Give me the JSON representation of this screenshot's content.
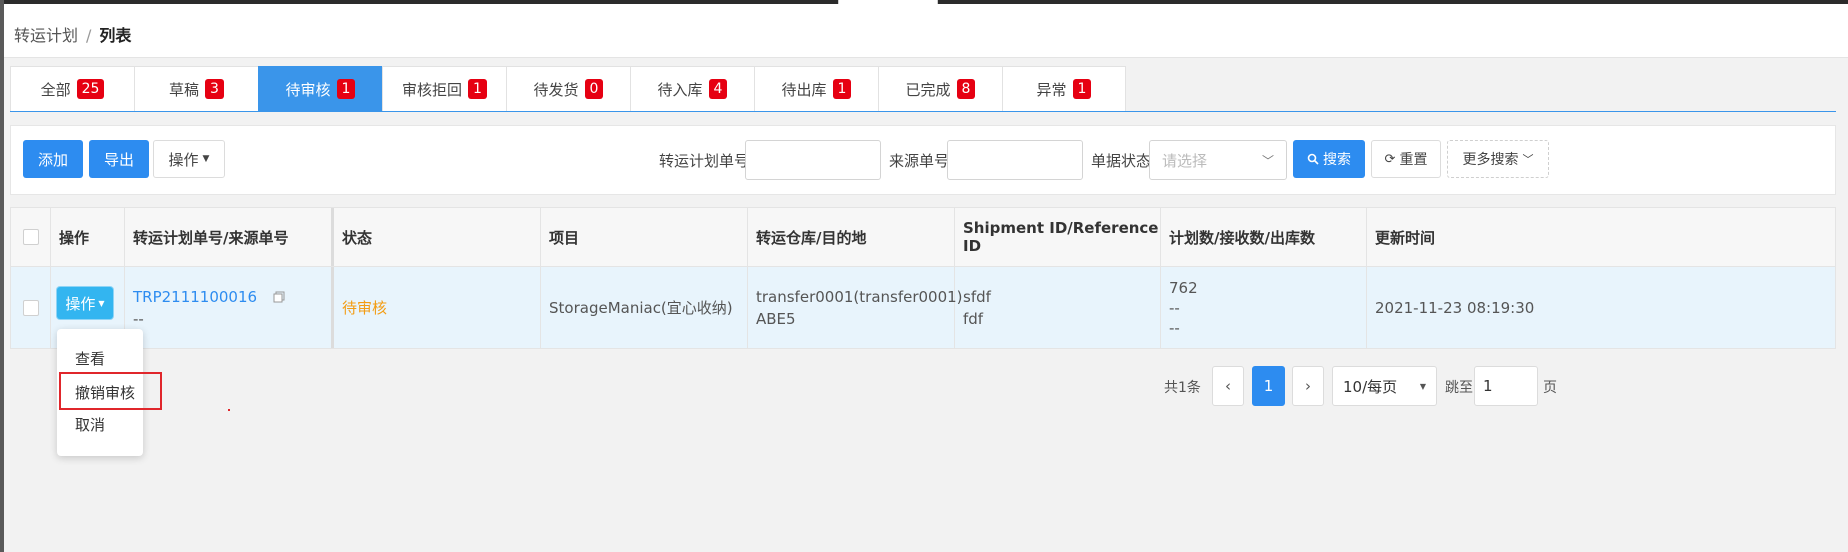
{
  "breadcrumb": {
    "parent": "转运计划",
    "separator": "/",
    "current": "列表"
  },
  "tabs": [
    {
      "label": "全部",
      "count": "25"
    },
    {
      "label": "草稿",
      "count": "3"
    },
    {
      "label": "待审核",
      "count": "1"
    },
    {
      "label": "审核拒回",
      "count": "1"
    },
    {
      "label": "待发货",
      "count": "0"
    },
    {
      "label": "待入库",
      "count": "4"
    },
    {
      "label": "待出库",
      "count": "1"
    },
    {
      "label": "已完成",
      "count": "8"
    },
    {
      "label": "异常",
      "count": "1"
    }
  ],
  "toolbar": {
    "add_label": "添加",
    "export_label": "导出",
    "ops_label": "操作",
    "plan_no_label": "转运计划单号",
    "source_no_label": "来源单号",
    "status_label": "单据状态",
    "status_placeholder": "请选择",
    "search_label": "搜索",
    "reset_label": "重置",
    "more_search_label": "更多搜索"
  },
  "table": {
    "headers": [
      "操作",
      "转运计划单号/来源单号",
      "状态",
      "项目",
      "转运仓库/目的地",
      "Shipment ID/Reference ID",
      "计划数/接收数/出库数",
      "更新时间"
    ],
    "row": {
      "op_label": "操作",
      "plan_no": "TRP2111100016",
      "source_no": "--",
      "status": "待审核",
      "project": "StorageManiac(宜心收纳)",
      "warehouse": "transfer0001(transfer0001)",
      "destination": "ABE5",
      "shipment_id": "sfdf",
      "reference_id": "fdf",
      "planned": "762",
      "received": "--",
      "shipped": "--",
      "updated": "2021-11-23 08:19:30"
    }
  },
  "dropdown": {
    "items": [
      "查看",
      "撤销审核",
      "取消"
    ]
  },
  "pager": {
    "total": "共1条",
    "prev": "‹",
    "current_page": "1",
    "next": "›",
    "page_size": "10/每页",
    "jump_label": "跳至",
    "jump_value": "1",
    "page_unit": "页"
  },
  "colors": {
    "primary": "#2d8cf0",
    "active_tab": "#3a95ea",
    "badge": "#e60012",
    "status_pending": "#f39c12",
    "op_button": "#33b5f0"
  }
}
